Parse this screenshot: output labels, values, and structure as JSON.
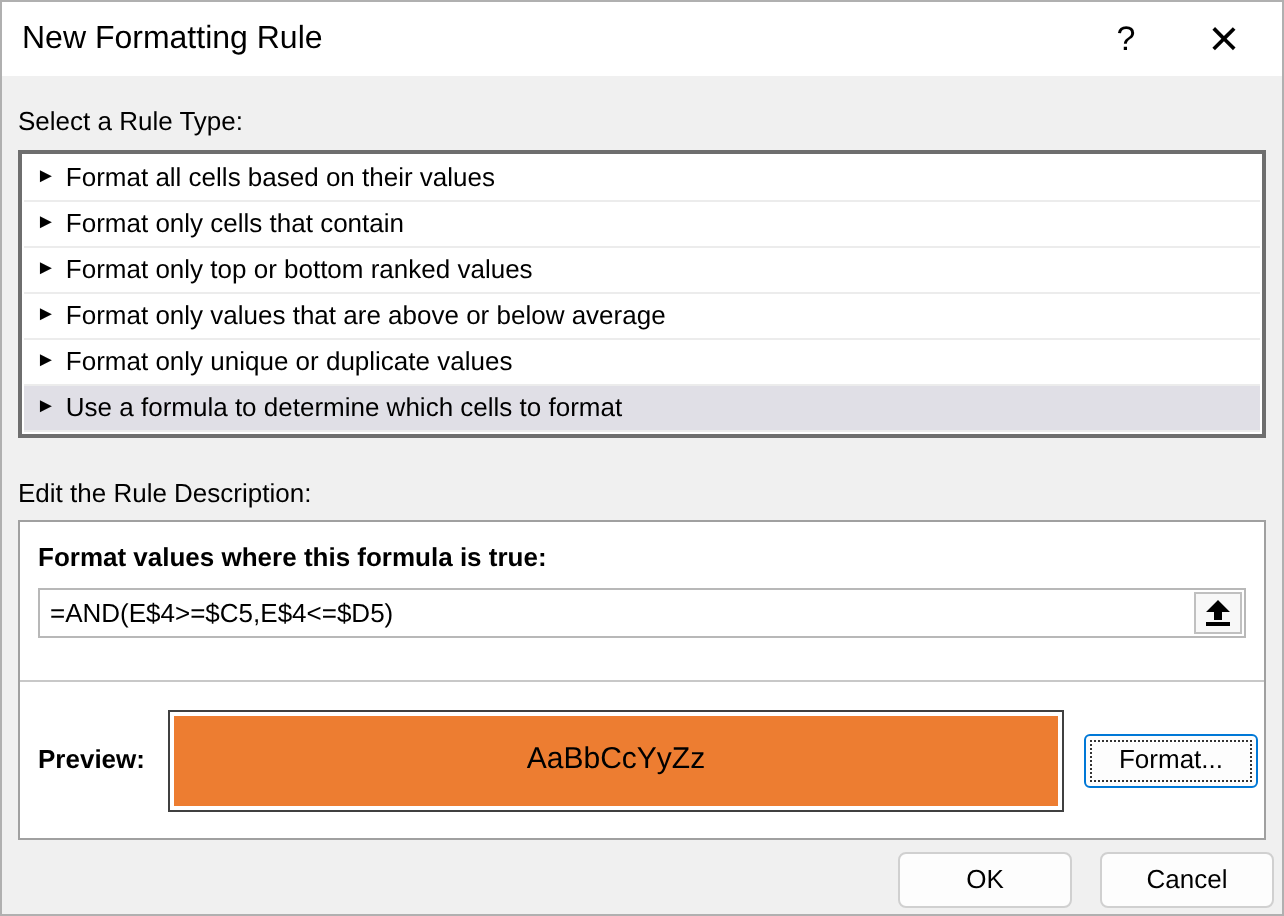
{
  "window": {
    "title": "New Formatting Rule",
    "help": "?",
    "close": "×"
  },
  "rule_types": {
    "label": "Select a Rule Type:",
    "items": [
      {
        "marker": "►",
        "label": "Format all cells based on their values",
        "selected": false
      },
      {
        "marker": "►",
        "label": "Format only cells that contain",
        "selected": false
      },
      {
        "marker": "►",
        "label": "Format only top or bottom ranked values",
        "selected": false
      },
      {
        "marker": "►",
        "label": "Format only values that are above or below average",
        "selected": false
      },
      {
        "marker": "►",
        "label": "Format only unique or duplicate values",
        "selected": false
      },
      {
        "marker": "►",
        "label": "Use a formula to determine which cells to format",
        "selected": true
      }
    ]
  },
  "rule_description": {
    "label": "Edit the Rule Description:",
    "formula_label": "Format values where this formula is true:",
    "formula": "=AND(E$4>=$C5,E$4<=$D5)",
    "preview_label": "Preview:",
    "preview": {
      "text": "AaBbCcYyZz",
      "color": "#ed7d31"
    },
    "format_button": "Format..."
  },
  "buttons": [
    "OK",
    "Cancel"
  ]
}
